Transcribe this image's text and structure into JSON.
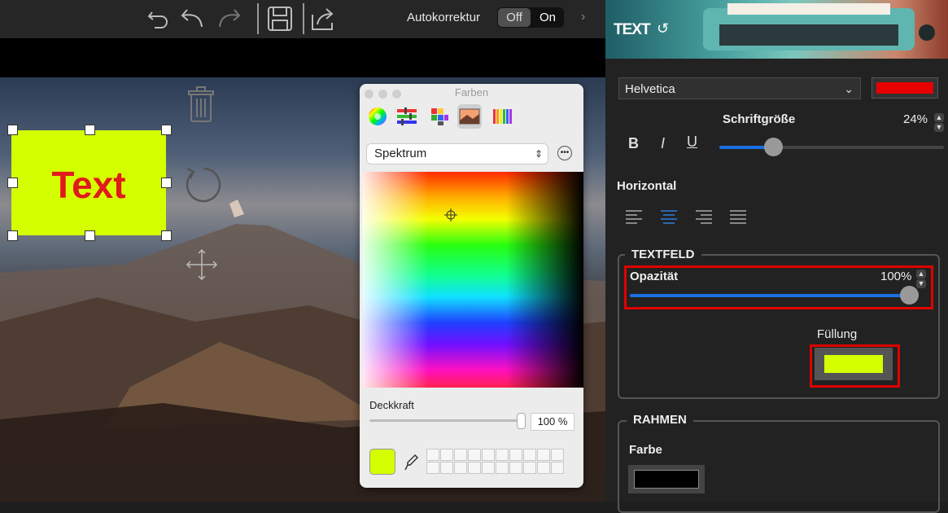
{
  "toolbar": {
    "icons": [
      "undo-icon",
      "undo-step-icon",
      "redo-icon",
      "save-icon",
      "share-icon"
    ],
    "autocorrect_label": "Autokorrektur",
    "toggle_off": "Off",
    "toggle_on": "On",
    "toggle_selected": "Off"
  },
  "canvas": {
    "textbox_text": "Text",
    "textbox_fill": "#d4ff00",
    "textbox_text_color": "#e01b1b",
    "icons": [
      "trash-icon",
      "rotate-icon",
      "move-icon"
    ]
  },
  "colors_panel": {
    "title": "Farben",
    "tabs": [
      "color-wheel-icon",
      "color-sliders-icon",
      "color-palettes-icon",
      "image-palettes-icon",
      "pencils-icon"
    ],
    "mode_select": "Spektrum",
    "opacity_label": "Deckkraft",
    "opacity_value": "100 %",
    "opacity_level": 1.0,
    "current_color": "#d4ff00"
  },
  "text_panel": {
    "title": "TEXT",
    "font_family": "Helvetica",
    "font_color": "#e60000",
    "size_label": "Schriftgröße",
    "size_value": "24%",
    "size_level": 0.24,
    "bold": "B",
    "italic": "I",
    "underline": "U",
    "horizontal_label": "Horizontal",
    "alignment_selected": "center",
    "textfield": {
      "title": "TEXTFELD",
      "opacity_label": "Opazität",
      "opacity_value": "100%",
      "opacity_level": 1.0,
      "fill_label": "Füllung",
      "fill_color": "#d4ff00"
    },
    "frame": {
      "title": "RAHMEN",
      "color_label": "Farbe",
      "color": "#000000"
    }
  }
}
